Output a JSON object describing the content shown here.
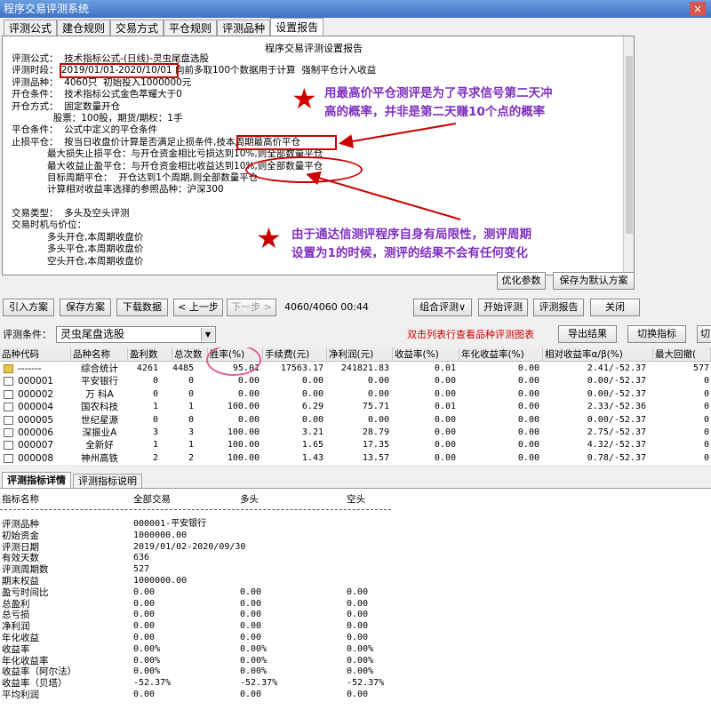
{
  "window": {
    "title": "程序交易评测系统",
    "close": "×"
  },
  "main_tabs": [
    "评测公式",
    "建仓规则",
    "交易方式",
    "平仓规则",
    "评测品种",
    "设置报告"
  ],
  "report": {
    "title": "程序交易评测设置报告",
    "lines": [
      "评测公式：  技术指标公式-(日线)-灵虫尾盘选股",
      "评测时段： 2019/01/01-2020/10/01 向前多取100个数据用于计算  强制平仓计入收益",
      "评测品种：  4060只  初始投入1000000元",
      "开仓条件：  技术指标公式金色萃耀大于0",
      "开仓方式：  固定数量开仓",
      "              股票：100股，期货/期权：1手",
      "平仓条件：  公式中定义的平仓条件",
      "止损平仓：  按当日收盘价计算是否满足止损条件,技本周期最高价平仓",
      "            最大损失止损平仓：与开仓资金相比亏损达到10%,则全部数量平仓",
      "            最大收益止盈平仓：与开仓资金相比收益达到10%,则全部数量平仓",
      "            目标周期平仓：  开仓达到1个周期,则全部数量平仓",
      "            计算相对收益率选择的参照品种：沪深300",
      "",
      "交易类型：  多头及空头评测",
      "交易时机与价位：",
      "            多头开仓,本周期收盘价",
      "            多头平仓,本周期收盘价",
      "            空头开仓,本周期收盘价"
    ],
    "optimize_button": "优化参数",
    "save_default_button": "保存为默认方案"
  },
  "annotations": {
    "note1": [
      "用最高价平仓测评是为了寻求信号第二天冲",
      "高的概率，并非是第二天赚10个点的概率"
    ],
    "note2": [
      "由于通达信测评程序自身有局限性，测评周期",
      "设置为1的时候，测评的结果不会有任何变化"
    ],
    "star": "★"
  },
  "toolbar": {
    "import": "引入方案",
    "save_plan": "保存方案",
    "download": "下载数据",
    "prev": "< 上一步",
    "next": "下一步 >",
    "progress": "4060/4060 00:44",
    "combo": "组合评测∨",
    "start": "开始评测",
    "report": "评测报告",
    "close": "关闭"
  },
  "condition": {
    "label": "评测条件：",
    "selected": "灵虫尾盘选股",
    "hint": "双击列表行查看品种评测图表",
    "export": "导出结果",
    "switch": "切换指标",
    "switch2": "切"
  },
  "table": {
    "headers": [
      "品种代码",
      "品种名称",
      "盈利数",
      "总次数",
      "胜率(%)",
      "手续费(元)",
      "净利润(元)",
      "收益率(%)",
      "年化收益率(%)",
      "相对收益率α/β(%)",
      "最大回撤("
    ],
    "rows": [
      [
        "-------",
        "综合统计",
        "4261",
        "4485",
        "95.01",
        "17563.17",
        "241821.83",
        "0.01",
        "0.00",
        "2.41/-52.37",
        "577"
      ],
      [
        "000001",
        "平安银行",
        "0",
        "0",
        "0.00",
        "0.00",
        "0.00",
        "0.00",
        "0.00",
        "0.00/-52.37",
        "0"
      ],
      [
        "000002",
        "万 科A",
        "0",
        "0",
        "0.00",
        "0.00",
        "0.00",
        "0.00",
        "0.00",
        "0.00/-52.37",
        "0"
      ],
      [
        "000004",
        "国农科技",
        "1",
        "1",
        "100.00",
        "6.29",
        "75.71",
        "0.01",
        "0.00",
        "2.33/-52.36",
        "0"
      ],
      [
        "000005",
        "世纪星源",
        "0",
        "0",
        "0.00",
        "0.00",
        "0.00",
        "0.00",
        "0.00",
        "0.00/-52.37",
        "0"
      ],
      [
        "000006",
        "深振业A",
        "3",
        "3",
        "100.00",
        "3.21",
        "28.79",
        "0.00",
        "0.00",
        "2.75/-52.37",
        "0"
      ],
      [
        "000007",
        "全新好",
        "1",
        "1",
        "100.00",
        "1.65",
        "17.35",
        "0.00",
        "0.00",
        "4.32/-52.37",
        "0"
      ],
      [
        "000008",
        "神州高铁",
        "2",
        "2",
        "100.00",
        "1.43",
        "13.57",
        "0.00",
        "0.00",
        "0.78/-52.37",
        "0"
      ]
    ]
  },
  "detail_tabs": [
    "评测指标详情",
    "评测指标说明"
  ],
  "detail": {
    "headers": [
      "指标名称",
      "全部交易",
      "多头",
      "空头"
    ],
    "rows": [
      [
        "评测品种",
        "000001-平安银行",
        "",
        ""
      ],
      [
        "初始资金",
        "1000000.00",
        "",
        ""
      ],
      [
        "评测日期",
        "2019/01/02-2020/09/30",
        "",
        ""
      ],
      [
        "有效天数",
        "636",
        "",
        ""
      ],
      [
        "评测周期数",
        "527",
        "",
        ""
      ],
      [
        "期末权益",
        "1000000.00",
        "",
        ""
      ],
      [
        "盈亏时间比",
        "0.00",
        "0.00",
        "0.00"
      ],
      [
        "总盈利",
        "0.00",
        "0.00",
        "0.00"
      ],
      [
        "总亏损",
        "0.00",
        "0.00",
        "0.00"
      ],
      [
        "净利润",
        "0.00",
        "0.00",
        "0.00"
      ],
      [
        "年化收益",
        "0.00",
        "0.00",
        "0.00"
      ],
      [
        "收益率",
        "0.00%",
        "0.00%",
        "0.00%"
      ],
      [
        "年化收益率",
        "0.00%",
        "0.00%",
        "0.00%"
      ],
      [
        "收益率（阿尔法）",
        "0.00%",
        "0.00%",
        "0.00%"
      ],
      [
        "收益率（贝塔）",
        "-52.37%",
        "-52.37%",
        "-52.37%"
      ],
      [
        "平均利润",
        "0.00",
        "0.00",
        "0.00"
      ]
    ]
  }
}
